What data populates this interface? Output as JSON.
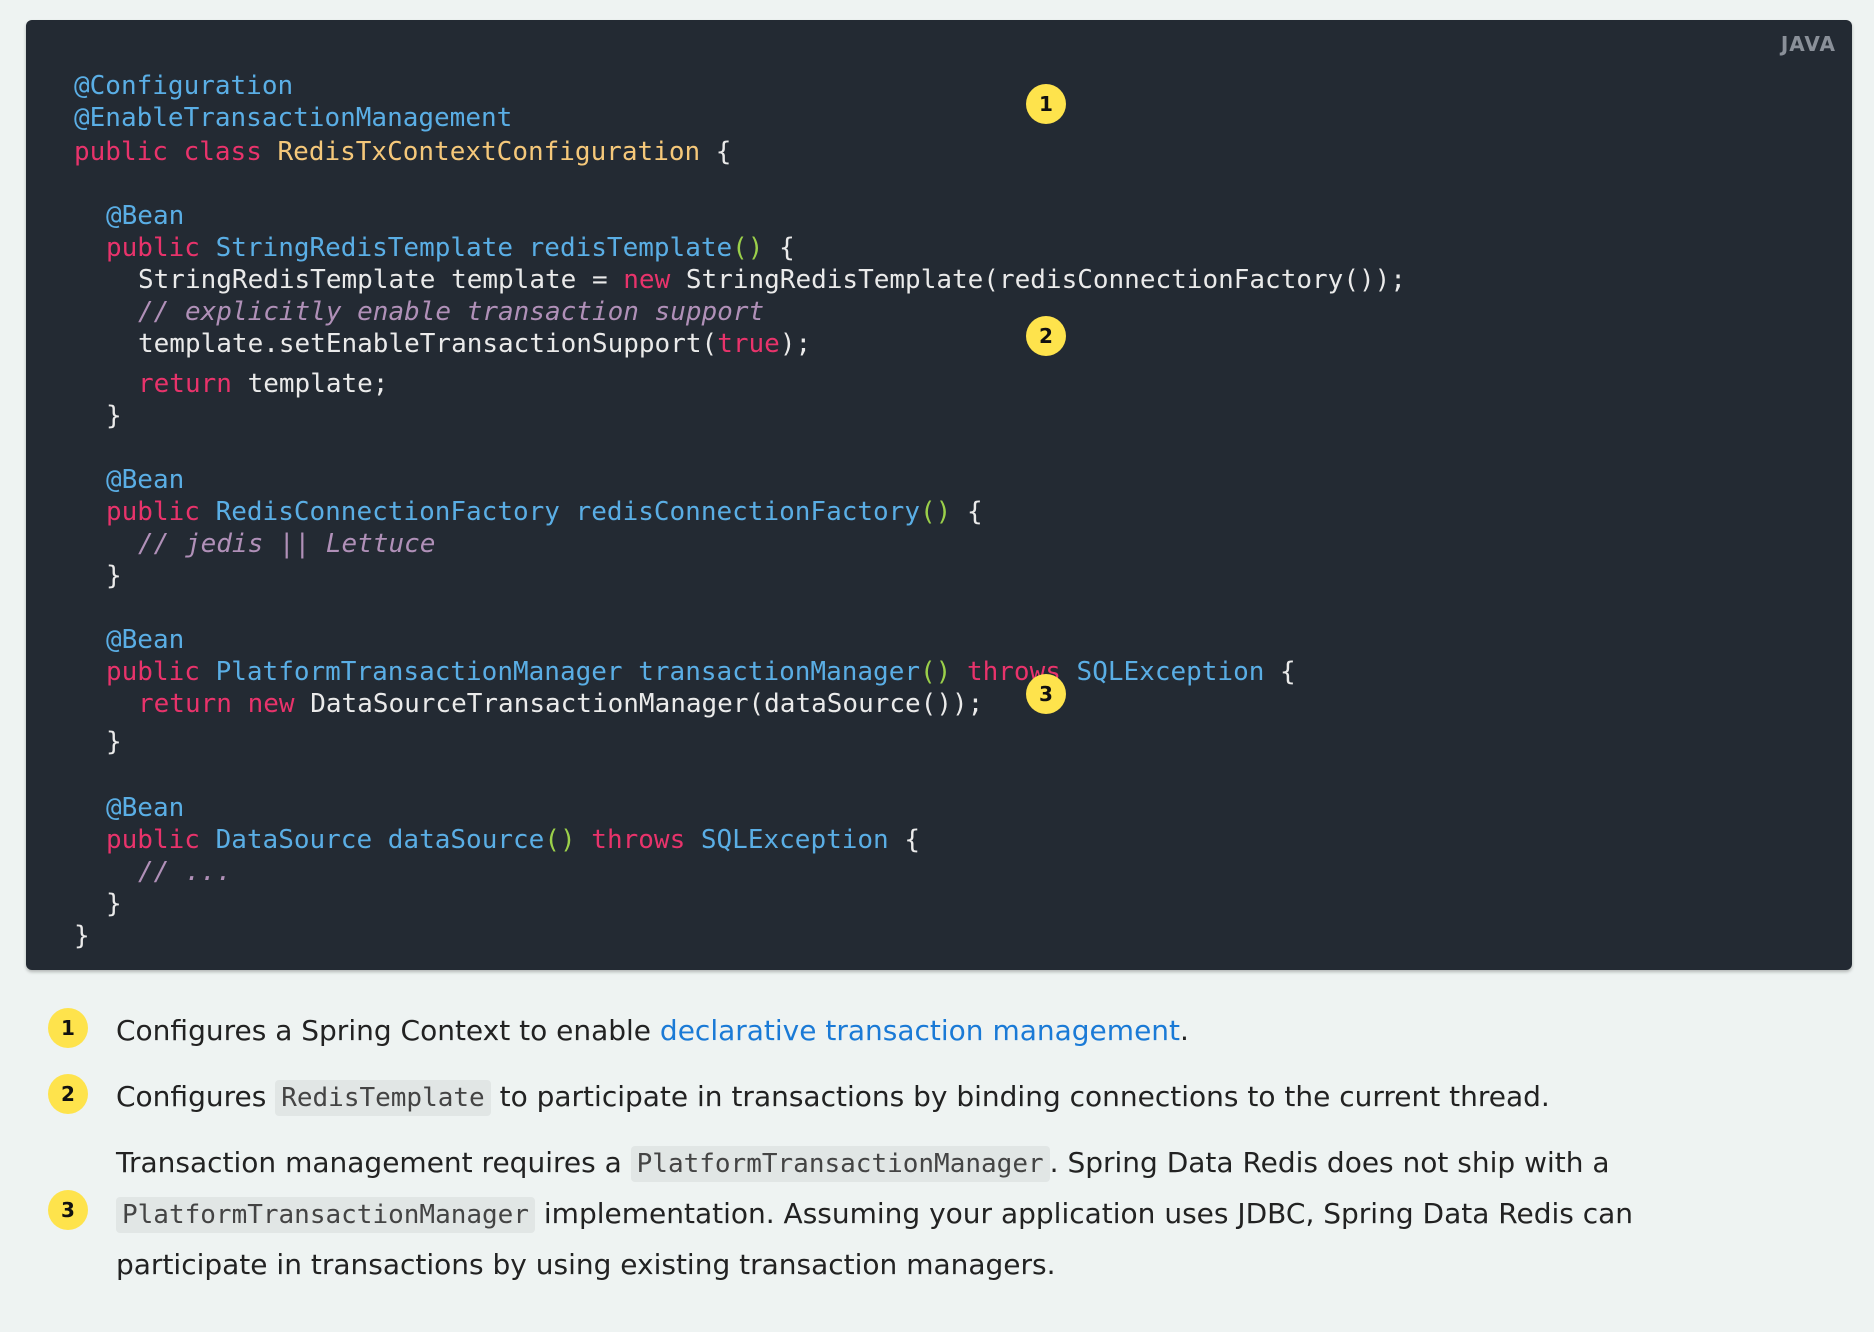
{
  "lang_label": "JAVA",
  "badges": [
    "1",
    "2",
    "3"
  ],
  "code": {
    "l1": "@Configuration",
    "l2": "@EnableTransactionManagement",
    "l3_kw1": "public",
    "l3_kw2": "class",
    "l3_cls": "RedisTxContextConfiguration",
    "l3_rest": " {",
    "l5": "@Bean",
    "l6_kw": "public",
    "l6_typ": "StringRedisTemplate",
    "l6_fn": "redisTemplate",
    "l6_par": "()",
    "l6_rest": " {",
    "l7_a": "StringRedisTemplate template = ",
    "l7_kw": "new",
    "l7_b": " StringRedisTemplate(redisConnectionFactory());",
    "l8": "// explicitly enable transaction support",
    "l9_a": "template.setEnableTransactionSupport(",
    "l9_kw": "true",
    "l9_b": ");",
    "l10_kw": "return",
    "l10_b": " template;",
    "close": "}",
    "l13": "@Bean",
    "l14_kw": "public",
    "l14_typ": "RedisConnectionFactory",
    "l14_fn": "redisConnectionFactory",
    "l14_par": "()",
    "l14_rest": " {",
    "l15": "// jedis || Lettuce",
    "l18": "@Bean",
    "l19_kw": "public",
    "l19_typ": "PlatformTransactionManager",
    "l19_fn": "transactionManager",
    "l19_par": "()",
    "l19_kw2": "throws",
    "l19_typ2": "SQLException",
    "l19_rest": " {",
    "l20_kw1": "return",
    "l20_kw2": "new",
    "l20_b": " DataSourceTransactionManager(dataSource());",
    "l23": "@Bean",
    "l24_kw": "public",
    "l24_typ": "DataSource",
    "l24_fn": "dataSource",
    "l24_par": "()",
    "l24_kw2": "throws",
    "l24_typ2": "SQLException",
    "l24_rest": " {",
    "l25": "// ..."
  },
  "callouts": {
    "c1_text": "Configures a Spring Context to enable ",
    "c1_link": "declarative transaction management",
    "c1_end": ".",
    "c2_a": "Configures ",
    "c2_code": "RedisTemplate",
    "c2_b": " to participate in transactions by binding connections to the current thread.",
    "c3_a": "Transaction management requires a ",
    "c3_code1": "PlatformTransactionManager",
    "c3_b": ". Spring Data Redis does not ship with a",
    "c3_code2": "PlatformTransactionManager",
    "c3_c": " implementation. Assuming your application uses JDBC, Spring Data Redis can",
    "c3_d": "participate in transactions by using existing transaction managers."
  },
  "colors": {
    "code_bg": "#232a33",
    "annotation": "#5aaee5",
    "keyword": "#e8336b",
    "class_name": "#f5c87a",
    "paren": "#9bd04a",
    "comment": "#b090b8",
    "badge": "#fee34c",
    "link": "#1a7ad6"
  }
}
